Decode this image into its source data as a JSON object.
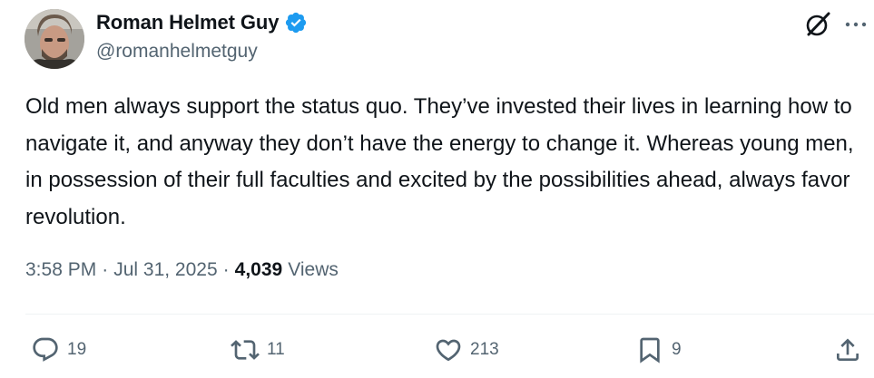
{
  "author": {
    "display_name": "Roman Helmet Guy",
    "handle": "@romanhelmetguy",
    "verified": true
  },
  "icons": {
    "verified": "verified-badge-icon",
    "grok": "grok-icon",
    "more": "more-horizontal-icon",
    "reply": "reply-icon",
    "retweet": "retweet-icon",
    "like": "heart-icon",
    "bookmark": "bookmark-icon",
    "share": "share-icon"
  },
  "tweet": {
    "text": "Old men always support the status quo. They’ve invested their lives in learning how to navigate it, and anyway they don’t have the energy to change it. Whereas young men, in possession of their full faculties and excited by the possibilities ahead, always favor revolution.",
    "time": "3:58 PM",
    "date": "Jul 31, 2025",
    "separator": "·",
    "views_count": "4,039",
    "views_label": "Views"
  },
  "actions": {
    "replies": "19",
    "retweets": "11",
    "likes": "213",
    "bookmarks": "9"
  },
  "colors": {
    "text_primary": "#0f1419",
    "text_secondary": "#536471",
    "verified_blue": "#1d9bf0",
    "divider": "#eff3f4"
  }
}
